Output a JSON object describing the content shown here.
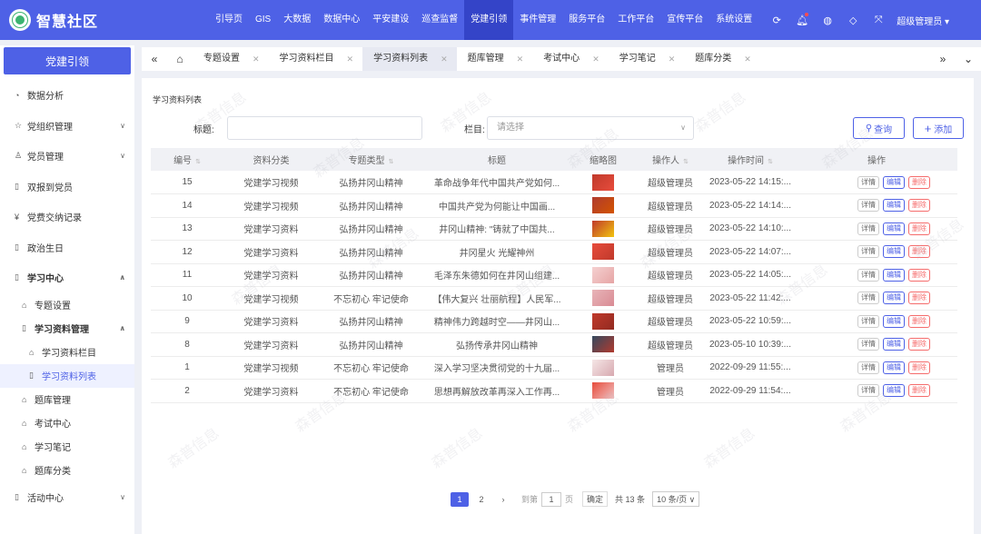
{
  "app": {
    "title": "智慧社区"
  },
  "nav": {
    "items": [
      "引导页",
      "GIS",
      "大数据",
      "数据中心",
      "平安建设",
      "巡查监督",
      "党建引领",
      "事件管理",
      "服务平台",
      "工作平台",
      "宣传平台",
      "系统设置"
    ],
    "active": "党建引领",
    "user": "超级管理员"
  },
  "sidebar": {
    "head": "党建引领",
    "items": [
      {
        "label": "数据分析"
      },
      {
        "label": "党组织管理"
      },
      {
        "label": "党员管理"
      },
      {
        "label": "双报到党员"
      },
      {
        "label": "党费交纳记录"
      },
      {
        "label": "政治生日"
      },
      {
        "label": "学习中心"
      },
      {
        "label": "专题设置"
      },
      {
        "label": "学习资料管理"
      },
      {
        "label": "学习资料栏目"
      },
      {
        "label": "学习资料列表"
      },
      {
        "label": "题库管理"
      },
      {
        "label": "考试中心"
      },
      {
        "label": "学习笔记"
      },
      {
        "label": "题库分类"
      },
      {
        "label": "活动中心"
      }
    ]
  },
  "tabs": [
    "专题设置",
    "学习资料栏目",
    "学习资料列表",
    "题库管理",
    "考试中心",
    "学习笔记",
    "题库分类"
  ],
  "panel": {
    "title": "学习资料列表",
    "filter": {
      "title_label": "标题:",
      "column_label": "栏目:",
      "column_placeholder": "请选择",
      "search": "查询",
      "add": "添加"
    }
  },
  "table": {
    "headers": [
      "编号",
      "资料分类",
      "专题类型",
      "标题",
      "缩略图",
      "操作人",
      "操作时间",
      "操作"
    ],
    "rows": [
      {
        "id": "15",
        "cat": "党建学习视频",
        "topic": "弘扬井冈山精神",
        "title": "革命战争年代中国共产党如何...",
        "user": "超级管理员",
        "time": "2023-05-22 14:15:..."
      },
      {
        "id": "14",
        "cat": "党建学习视频",
        "topic": "弘扬井冈山精神",
        "title": "中国共产党为何能让中国画...",
        "user": "超级管理员",
        "time": "2023-05-22 14:14:..."
      },
      {
        "id": "13",
        "cat": "党建学习资料",
        "topic": "弘扬井冈山精神",
        "title": "井冈山精神: \"铸就了中国共...",
        "user": "超级管理员",
        "time": "2023-05-22 14:10:..."
      },
      {
        "id": "12",
        "cat": "党建学习资料",
        "topic": "弘扬井冈山精神",
        "title": "井冈星火 光耀神州",
        "user": "超级管理员",
        "time": "2023-05-22 14:07:..."
      },
      {
        "id": "11",
        "cat": "党建学习资料",
        "topic": "弘扬井冈山精神",
        "title": "毛泽东朱德如何在井冈山组建...",
        "user": "超级管理员",
        "time": "2023-05-22 14:05:..."
      },
      {
        "id": "10",
        "cat": "党建学习视频",
        "topic": "不忘初心 牢记使命",
        "title": "【伟大复兴 壮丽航程】人民军...",
        "user": "超级管理员",
        "time": "2023-05-22 11:42:..."
      },
      {
        "id": "9",
        "cat": "党建学习资料",
        "topic": "弘扬井冈山精神",
        "title": "精神伟力跨越时空——井冈山...",
        "user": "超级管理员",
        "time": "2023-05-22 10:59:..."
      },
      {
        "id": "8",
        "cat": "党建学习资料",
        "topic": "弘扬井冈山精神",
        "title": "弘扬传承井冈山精神",
        "user": "超级管理员",
        "time": "2023-05-10 10:39:..."
      },
      {
        "id": "1",
        "cat": "党建学习视频",
        "topic": "不忘初心 牢记使命",
        "title": "深入学习坚决贯彻党的十九届...",
        "user": "管理员",
        "time": "2022-09-29 11:55:..."
      },
      {
        "id": "2",
        "cat": "党建学习资料",
        "topic": "不忘初心 牢记使命",
        "title": "思想再解放改革再深入工作再...",
        "user": "管理员",
        "time": "2022-09-29 11:54:..."
      }
    ],
    "ops": {
      "detail": "详情",
      "edit": "编辑",
      "delete": "删除"
    }
  },
  "pager": {
    "pages": [
      "1",
      "2"
    ],
    "goto_label": "到第",
    "goto_value": "1",
    "page_unit": "页",
    "confirm": "确定",
    "total": "共 13 条",
    "size": "10 条/页"
  },
  "watermark": "森普信息",
  "colors": {
    "primary": "#4e61e6",
    "danger": "#f56c6c"
  }
}
